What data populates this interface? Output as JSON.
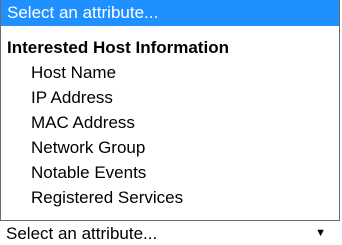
{
  "dropdown": {
    "placeholder": "Select an attribute...",
    "group_label": "Interested Host Information",
    "options": [
      {
        "label": "Host Name"
      },
      {
        "label": "IP Address"
      },
      {
        "label": "MAC Address"
      },
      {
        "label": "Network Group"
      },
      {
        "label": "Notable Events"
      },
      {
        "label": "Registered Services"
      }
    ]
  },
  "select_closed": {
    "value": "Select an attribute...",
    "arrow_icon": "▼"
  },
  "colors": {
    "highlight": "#1e90ff"
  }
}
